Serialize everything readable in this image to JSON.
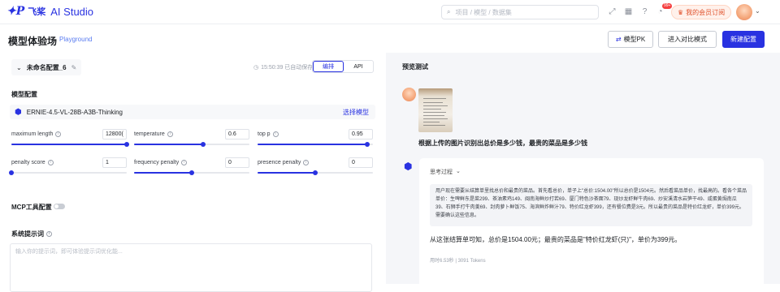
{
  "app": {
    "logo_mark": "✦P",
    "logo_cn": "飞桨",
    "name": "AI Studio"
  },
  "search": {
    "placeholder": "项目 / 模型 / 数据集"
  },
  "notifications": {
    "count": "99+"
  },
  "promo": {
    "label": "我的会员订阅"
  },
  "header": {
    "title": "模型体验场",
    "subtitle": "Playground",
    "pk_button": "模型PK",
    "compare_button": "进入对比模式",
    "new_button": "新建配置"
  },
  "config": {
    "name": "未命名配置_6",
    "saved_text": "15:50:39 已自动保存",
    "tabs": [
      "编排",
      "API"
    ]
  },
  "model": {
    "section": "模型配置",
    "name": "ERNIE-4.5-VL-28B-A3B-Thinking",
    "select_label": "选择模型"
  },
  "params": [
    {
      "label": "maximum length",
      "value": "12800(",
      "fraction": 1.0
    },
    {
      "label": "temperature",
      "value": "0.6",
      "fraction": 0.6
    },
    {
      "label": "top p",
      "value": "0.95",
      "fraction": 0.95
    },
    {
      "label": "penalty score",
      "value": "1",
      "fraction": 0.0
    },
    {
      "label": "frequency penalty",
      "value": "0",
      "fraction": 0.5
    },
    {
      "label": "presence penalty",
      "value": "0",
      "fraction": 0.5
    }
  ],
  "mcp": {
    "label": "MCP工具配置",
    "enabled": false
  },
  "system_prompt": {
    "label": "系统提示词",
    "placeholder": "输入你的提示词，即可体验提示词优化能..."
  },
  "preview": {
    "title": "预览测试",
    "question": "根据上传的图片识别出总价是多少钱，最贵的菜品是多少钱",
    "think_label": "思考过程",
    "think_text": "用户现在需要从结算单里找总价和最贵的菜品。首先看总价，单子上\"总价:1504.00\"所以总价是1504元。然后看菜品单价，找最高的。看各个菜品单价：生啤鲜东是菜299、茶油素鸡149、闽南海鲜炒打若69、厦门特色沙茶面79、现炒龙虾鲜牛肉69、炒安溪清水岩笋干49、咸蛋黄焗南瓜39、石狮手打牛肉羹69、封肉萝卜鲜饭75、海滨鲜炸鲜汁79、特价红龙虾399，还有餐位费是3元。所以最贵的菜品是特价红龙虾，单价399元。需要确认这些信息。",
    "result": "从这张结算单可知，总价是1504.00元；最贵的菜品是\"特价红龙虾(只)\"，单价为399元。",
    "meta": "用时6.53秒 | 3091 Tokens"
  },
  "colors": {
    "accent": "#2932e1",
    "preview_bg": "#f5f6f9"
  }
}
